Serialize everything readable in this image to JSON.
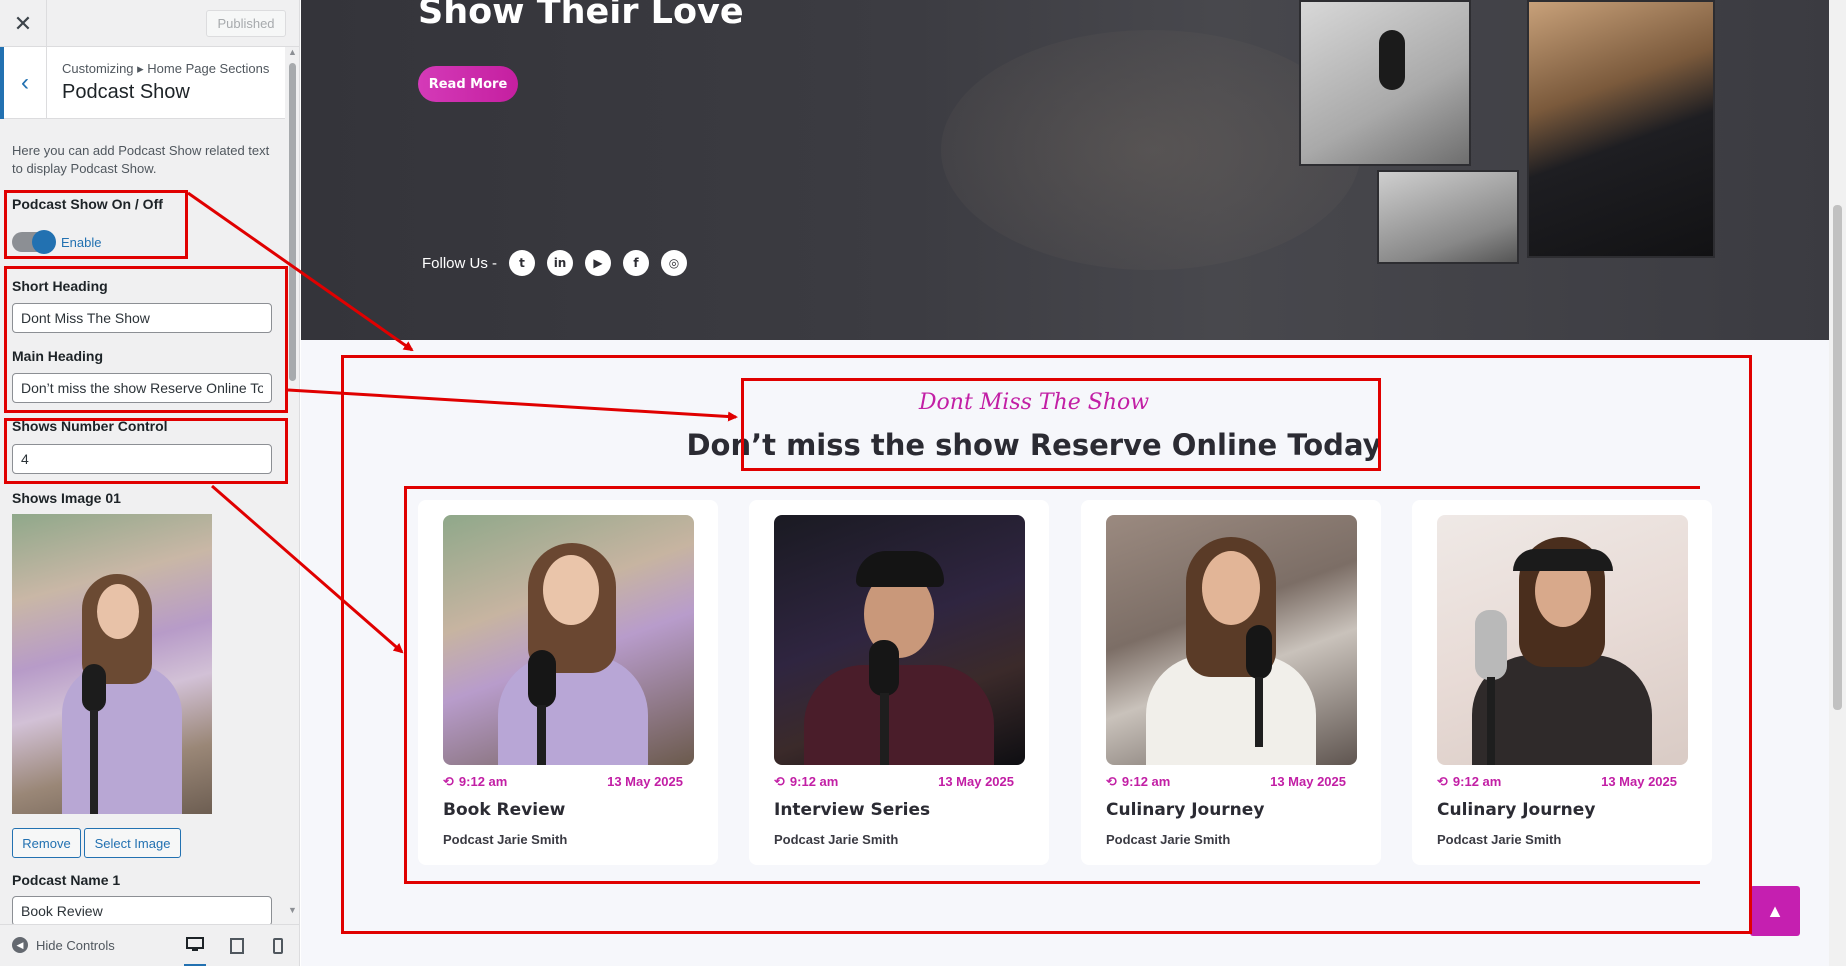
{
  "sidebar": {
    "close_icon": "close-icon",
    "published_label": "Published",
    "breadcrumb": "Customizing ▸ Home Page Sections",
    "title": "Podcast Show",
    "description": "Here you can add Podcast Show related text to display Podcast Show.",
    "toggle_label": "Podcast Show On / Off",
    "toggle_state": "Enable",
    "short_heading_label": "Short Heading",
    "short_heading_value": "Dont Miss The Show",
    "main_heading_label": "Main Heading",
    "main_heading_value": "Don’t miss the show Reserve Online To",
    "shows_number_label": "Shows Number Control",
    "shows_number_value": "4",
    "image_label": "Shows Image 01",
    "remove_label": "Remove",
    "select_image_label": "Select Image",
    "podcast_name_label": "Podcast Name 1",
    "podcast_name_value": "Book Review",
    "hide_controls": "Hide Controls"
  },
  "hero": {
    "title": "Show Their Love",
    "read_more": "Read More",
    "follow_us": "Follow Us -",
    "social_icons": [
      "twitter-icon",
      "linkedin-icon",
      "youtube-icon",
      "facebook-icon",
      "instagram-icon"
    ]
  },
  "shows": {
    "short_heading": "Dont Miss The Show",
    "main_heading": "Don’t miss the show Reserve Online Today",
    "cards": [
      {
        "time": "9:12 am",
        "date": "13 May 2025",
        "title": "Book Review",
        "host": "Podcast Jarie Smith"
      },
      {
        "time": "9:12 am",
        "date": "13 May 2025",
        "title": "Interview Series",
        "host": "Podcast Jarie Smith"
      },
      {
        "time": "9:12 am",
        "date": "13 May 2025",
        "title": "Culinary Journey",
        "host": "Podcast Jarie Smith"
      },
      {
        "time": "9:12 am",
        "date": "13 May 2025",
        "title": "Culinary Journey",
        "host": "Podcast Jarie Smith"
      }
    ]
  },
  "colors": {
    "accent": "#c21fa5",
    "wp_blue": "#2271b1",
    "annotation": "#e00000",
    "hero_bg": "#3c3c42"
  }
}
